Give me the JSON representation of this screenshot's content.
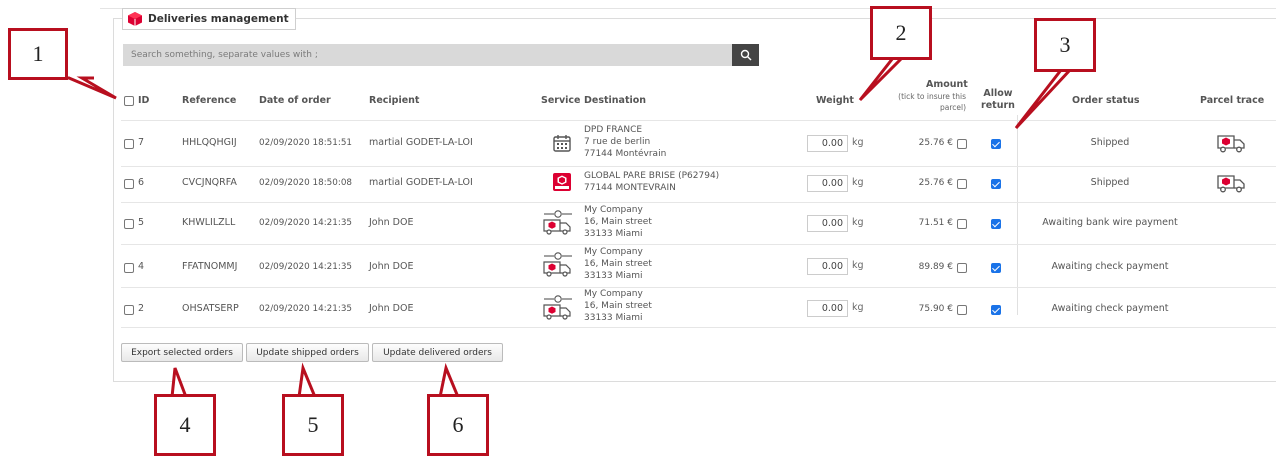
{
  "panel": {
    "title": "Deliveries management"
  },
  "search": {
    "placeholder": "Search something, separate values with ;"
  },
  "headers": {
    "id": "ID",
    "reference": "Reference",
    "date": "Date of order",
    "recipient": "Recipient",
    "service": "Service",
    "destination": "Destination",
    "weight": "Weight",
    "amount": "Amount",
    "amount_note_1": "(tick to insure this",
    "amount_note_2": "parcel)",
    "allow_return_1": "Allow",
    "allow_return_2": "return",
    "order_status": "Order status",
    "parcel_trace": "Parcel trace"
  },
  "rows": [
    {
      "id": "7",
      "reference": "HHLQQHGIJ",
      "date": "02/09/2020 18:51:51",
      "recipient": "martial GODET-LA-LOI",
      "service_icon": "calendar-icon",
      "dest1": "DPD FRANCE",
      "dest2": "7 rue de berlin",
      "dest3": "77144 Montévrain",
      "weight": "0.00",
      "unit": "kg",
      "amount": "25.76 €",
      "insure": false,
      "allow_return": true,
      "status": "Shipped",
      "trace_icon": "truck-icon"
    },
    {
      "id": "6",
      "reference": "CVCJNQRFA",
      "date": "02/09/2020 18:50:08",
      "recipient": "martial GODET-LA-LOI",
      "service_icon": "relay-icon",
      "dest1": "GLOBAL PARE BRISE (P62794)",
      "dest2": "77144 MONTEVRAIN",
      "dest3": "",
      "weight": "0.00",
      "unit": "kg",
      "amount": "25.76 €",
      "insure": false,
      "allow_return": true,
      "status": "Shipped",
      "trace_icon": "truck-icon"
    },
    {
      "id": "5",
      "reference": "KHWLILZLL",
      "date": "02/09/2020 14:21:35",
      "recipient": "John DOE",
      "service_icon": "predict-truck-icon",
      "dest1": "My Company",
      "dest2": "16, Main street",
      "dest3": "33133 Miami",
      "weight": "0.00",
      "unit": "kg",
      "amount": "71.51 €",
      "insure": false,
      "allow_return": true,
      "status": "Awaiting bank wire payment",
      "trace_icon": ""
    },
    {
      "id": "4",
      "reference": "FFATNOMMJ",
      "date": "02/09/2020 14:21:35",
      "recipient": "John DOE",
      "service_icon": "predict-truck-icon",
      "dest1": "My Company",
      "dest2": "16, Main street",
      "dest3": "33133 Miami",
      "weight": "0.00",
      "unit": "kg",
      "amount": "89.89 €",
      "insure": false,
      "allow_return": true,
      "status": "Awaiting check payment",
      "trace_icon": ""
    },
    {
      "id": "2",
      "reference": "OHSATSERP",
      "date": "02/09/2020 14:21:35",
      "recipient": "John DOE",
      "service_icon": "predict-truck-icon",
      "dest1": "My Company",
      "dest2": "16, Main street",
      "dest3": "33133 Miami",
      "weight": "0.00",
      "unit": "kg",
      "amount": "75.90 €",
      "insure": false,
      "allow_return": true,
      "status": "Awaiting check payment",
      "trace_icon": ""
    }
  ],
  "buttons": {
    "export": "Export selected orders",
    "update_shipped": "Update shipped orders",
    "update_delivered": "Update delivered orders"
  },
  "callouts": [
    "1",
    "2",
    "3",
    "4",
    "5",
    "6"
  ],
  "colors": {
    "callout_border": "#b80f1f",
    "accent_red": "#dc0032",
    "checkbox_blue": "#1a73e8"
  }
}
